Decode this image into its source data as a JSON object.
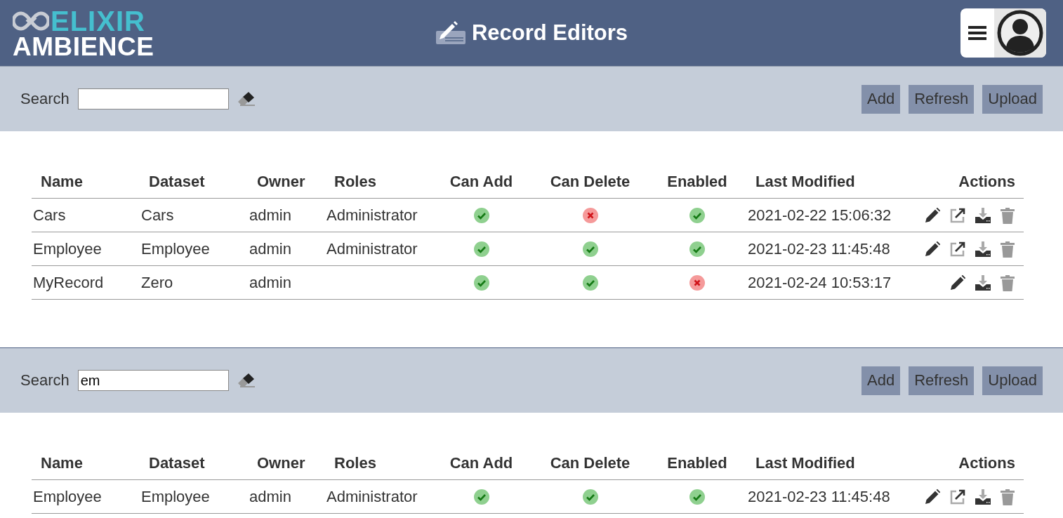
{
  "header": {
    "logo_top": "ELIXIR",
    "logo_bottom": "AMBIENCE",
    "title": "Record Editors"
  },
  "panels": [
    {
      "search": {
        "label": "Search"
      },
      "buttons": [
        "Add",
        "Refresh",
        "Upload"
      ],
      "table": {
        "columns": [
          "Name",
          "Dataset",
          "Owner",
          "Roles",
          "Can Add",
          "Can Delete",
          "Enabled",
          "Last Modified",
          "Actions"
        ],
        "rows": [
          {
            "name": "Cars",
            "dataset": "Cars",
            "owner": "admin",
            "roles": "Administrator",
            "can_add": true,
            "can_delete": false,
            "enabled": true,
            "last_modified": "2021-02-22 15:06:32",
            "actions": [
              {
                "kind": "edit"
              },
              {
                "kind": "open"
              },
              {
                "kind": "download"
              },
              {
                "kind": "delete"
              }
            ]
          },
          {
            "name": "Employee",
            "dataset": "Employee",
            "owner": "admin",
            "roles": "Administrator",
            "can_add": true,
            "can_delete": true,
            "enabled": true,
            "last_modified": "2021-02-23 11:45:48",
            "actions": [
              {
                "kind": "edit"
              },
              {
                "kind": "open"
              },
              {
                "kind": "download"
              },
              {
                "kind": "delete"
              }
            ]
          },
          {
            "name": "MyRecord",
            "dataset": "Zero",
            "owner": "admin",
            "can_add": true,
            "can_delete": true,
            "enabled": false,
            "last_modified": "2021-02-24 10:53:17",
            "actions": [
              {
                "kind": "edit"
              },
              {
                "kind": "download"
              },
              {
                "kind": "delete"
              }
            ]
          }
        ]
      }
    },
    {
      "search": {
        "label": "Search",
        "value": "em"
      },
      "buttons": [
        "Add",
        "Refresh",
        "Upload"
      ],
      "table": {
        "columns": [
          "Name",
          "Dataset",
          "Owner",
          "Roles",
          "Can Add",
          "Can Delete",
          "Enabled",
          "Last Modified",
          "Actions"
        ],
        "rows": [
          {
            "name": "Employee",
            "dataset": "Employee",
            "owner": "admin",
            "roles": "Administrator",
            "can_add": true,
            "can_delete": true,
            "enabled": true,
            "last_modified": "2021-02-23 11:45:48",
            "actions": [
              {
                "kind": "edit"
              },
              {
                "kind": "open"
              },
              {
                "kind": "download"
              },
              {
                "kind": "delete"
              }
            ]
          }
        ]
      }
    }
  ]
}
